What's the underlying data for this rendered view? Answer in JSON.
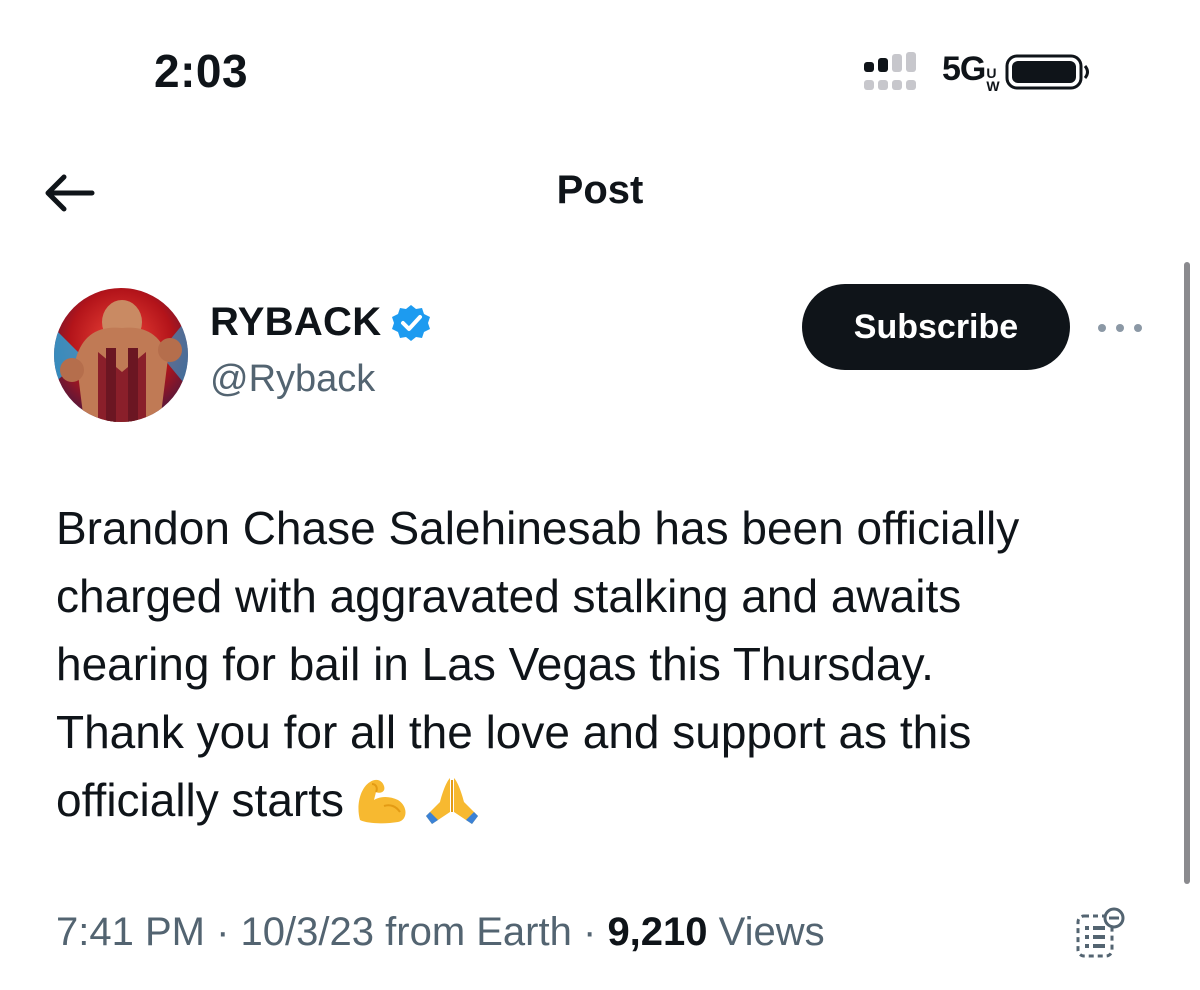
{
  "status_bar": {
    "time": "2:03",
    "network": "5G",
    "network_suffix_top": "U",
    "network_suffix_bottom": "W"
  },
  "header": {
    "title": "Post",
    "back_icon": "back-arrow-icon"
  },
  "author": {
    "display_name": "RYBACK",
    "handle": "@Ryback",
    "verified": true,
    "verified_color": "#1d9bf0"
  },
  "actions": {
    "subscribe_label": "Subscribe",
    "more_icon": "more-horizontal-icon"
  },
  "tweet": {
    "lines": [
      "Brandon Chase Salehinesab has been officially",
      "charged with aggravated stalking and awaits",
      "hearing for bail in Las Vegas this Thursday.",
      "Thank you for all the love and support as this",
      "officially starts"
    ],
    "emojis": [
      "flexed-biceps-emoji",
      "folded-hands-emoji"
    ]
  },
  "meta": {
    "time": "7:41 PM",
    "date": "10/3/23",
    "source": "from Earth",
    "views_count": "9,210",
    "views_label": "Views",
    "separator": "·"
  },
  "colors": {
    "text_primary": "#0f1419",
    "text_secondary": "#536471",
    "button_bg": "#0f1419"
  }
}
